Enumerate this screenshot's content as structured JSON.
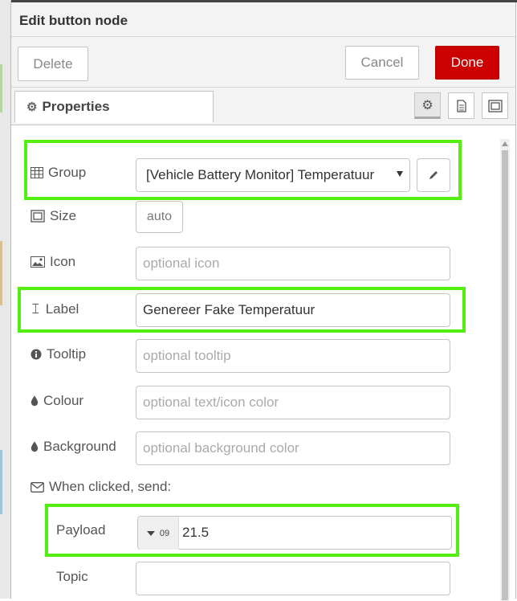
{
  "tray": {
    "title": "Edit button node"
  },
  "toolbar": {
    "delete_label": "Delete",
    "cancel_label": "Cancel",
    "done_label": "Done"
  },
  "tabs": {
    "properties_label": "Properties"
  },
  "form": {
    "group": {
      "label": "Group",
      "value": "[Vehicle Battery Monitor] Temperatuur"
    },
    "size": {
      "label": "Size",
      "value": "auto"
    },
    "icon": {
      "label": "Icon",
      "placeholder": "optional icon"
    },
    "label": {
      "label": "Label",
      "value": "Genereer Fake Temperatuur"
    },
    "tooltip": {
      "label": "Tooltip",
      "placeholder": "optional tooltip"
    },
    "colour": {
      "label": "Colour",
      "placeholder": "optional text/icon color"
    },
    "background": {
      "label": "Background",
      "placeholder": "optional background color"
    },
    "when_clicked": {
      "label": "When clicked, send:"
    },
    "payload": {
      "label": "Payload",
      "type_marker": "09",
      "value": "21.5"
    },
    "topic": {
      "label": "Topic",
      "value": ""
    }
  },
  "colors": {
    "highlight": "#55ee11",
    "done_button": "#cc0000"
  }
}
